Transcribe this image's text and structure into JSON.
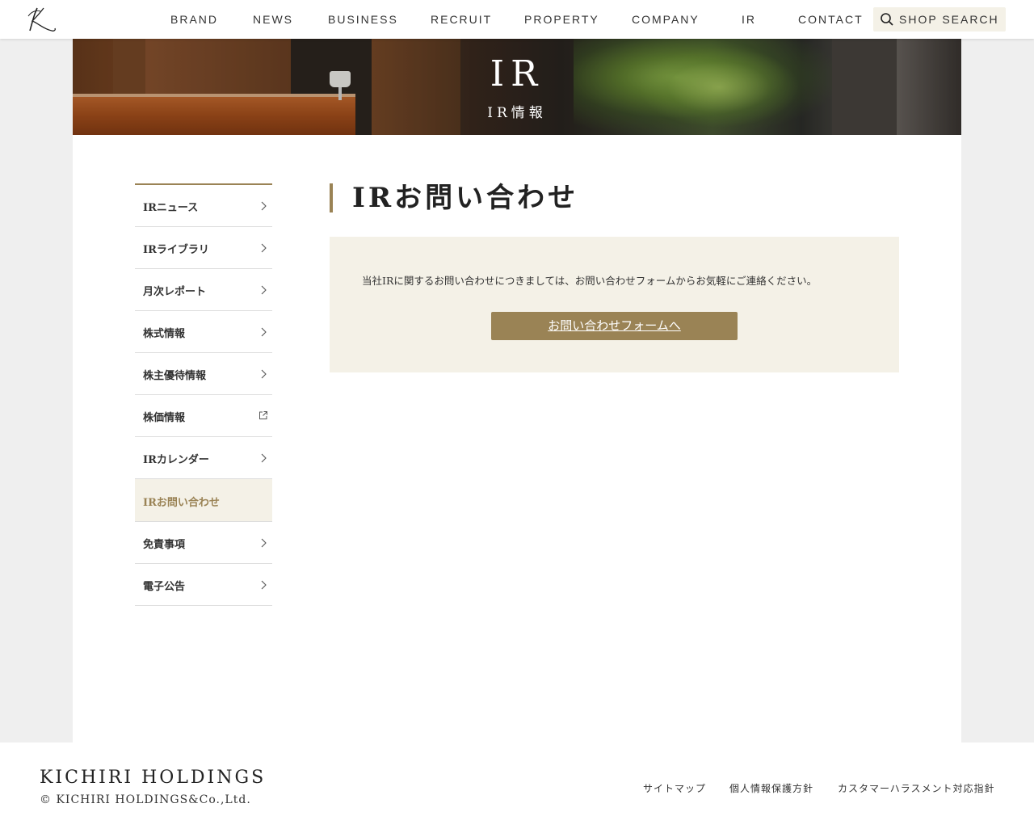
{
  "header": {
    "logo_alt": "K",
    "nav": [
      {
        "label": "BRAND"
      },
      {
        "label": "NEWS"
      },
      {
        "label": "BUSINESS"
      },
      {
        "label": "RECRUIT"
      },
      {
        "label": "PROPERTY"
      },
      {
        "label": "COMPANY"
      },
      {
        "label": "IR"
      },
      {
        "label": "CONTACT"
      }
    ],
    "shop_search_label": "SHOP SEARCH"
  },
  "hero": {
    "title": "IR",
    "subtitle": "IR情報"
  },
  "sidebar": {
    "items": [
      {
        "label": "IRニュース",
        "icon": "chevron-right-icon"
      },
      {
        "label": "IRライブラリ",
        "icon": "chevron-right-icon"
      },
      {
        "label": "月次レポート",
        "icon": "chevron-right-icon"
      },
      {
        "label": "株式情報",
        "icon": "chevron-right-icon"
      },
      {
        "label": "株主優待情報",
        "icon": "chevron-right-icon"
      },
      {
        "label": "株価情報",
        "icon": "external-link-icon"
      },
      {
        "label": "IRカレンダー",
        "icon": "chevron-right-icon"
      },
      {
        "label": "IRお問い合わせ",
        "active": true
      },
      {
        "label": "免責事項",
        "icon": "chevron-right-icon"
      },
      {
        "label": "電子公告",
        "icon": "chevron-right-icon"
      }
    ]
  },
  "main": {
    "title": "IRお問い合わせ",
    "message": "当社IRに関するお問い合わせにつきましては、お問い合わせフォームからお気軽にご連絡ください。",
    "button_label": "お問い合わせフォームへ"
  },
  "footer": {
    "brand": "KICHIRI HOLDINGS",
    "copyright": "© KICHIRI HOLDINGS&Co.,Ltd.",
    "links": [
      {
        "label": "サイトマップ"
      },
      {
        "label": "個人情報保護方針"
      },
      {
        "label": "カスタマーハラスメント対応指針"
      }
    ]
  },
  "colors": {
    "accent": "#9a8355",
    "panel_bg": "#f4f1e7",
    "page_bg": "#efefef"
  }
}
